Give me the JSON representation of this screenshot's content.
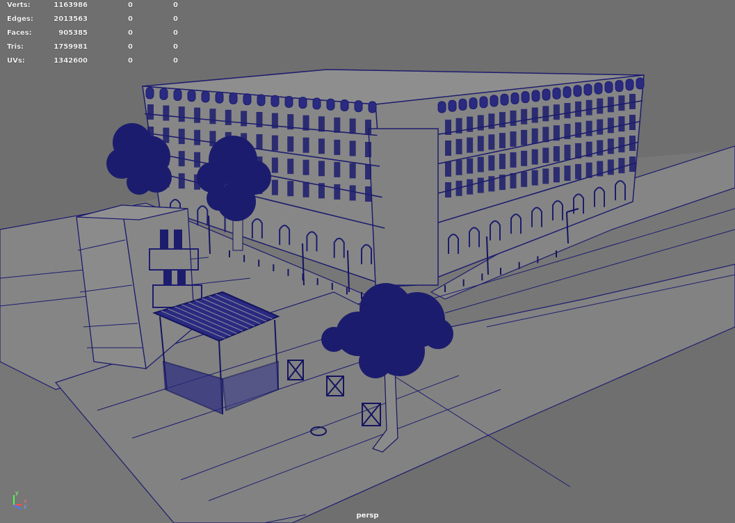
{
  "hud": {
    "rows": [
      {
        "label": "Verts:",
        "v1": "1163986",
        "v2": "0",
        "v3": "0"
      },
      {
        "label": "Edges:",
        "v1": "2013563",
        "v2": "0",
        "v3": "0"
      },
      {
        "label": "Faces:",
        "v1": "905385",
        "v2": "0",
        "v3": "0"
      },
      {
        "label": "Tris:",
        "v1": "1759981",
        "v2": "0",
        "v3": "0"
      },
      {
        "label": "UVs:",
        "v1": "1342600",
        "v2": "0",
        "v3": "0"
      }
    ]
  },
  "camera": {
    "label": "persp"
  },
  "axis": {
    "x": "x",
    "y": "y",
    "z": "z"
  },
  "colors": {
    "background": "#6f6f6f",
    "ground": "#858585",
    "wire": "#1c1c6e",
    "wire_dense": "#141460",
    "facade": "#8a8a8a",
    "hud_text": "#f2f2f2"
  }
}
